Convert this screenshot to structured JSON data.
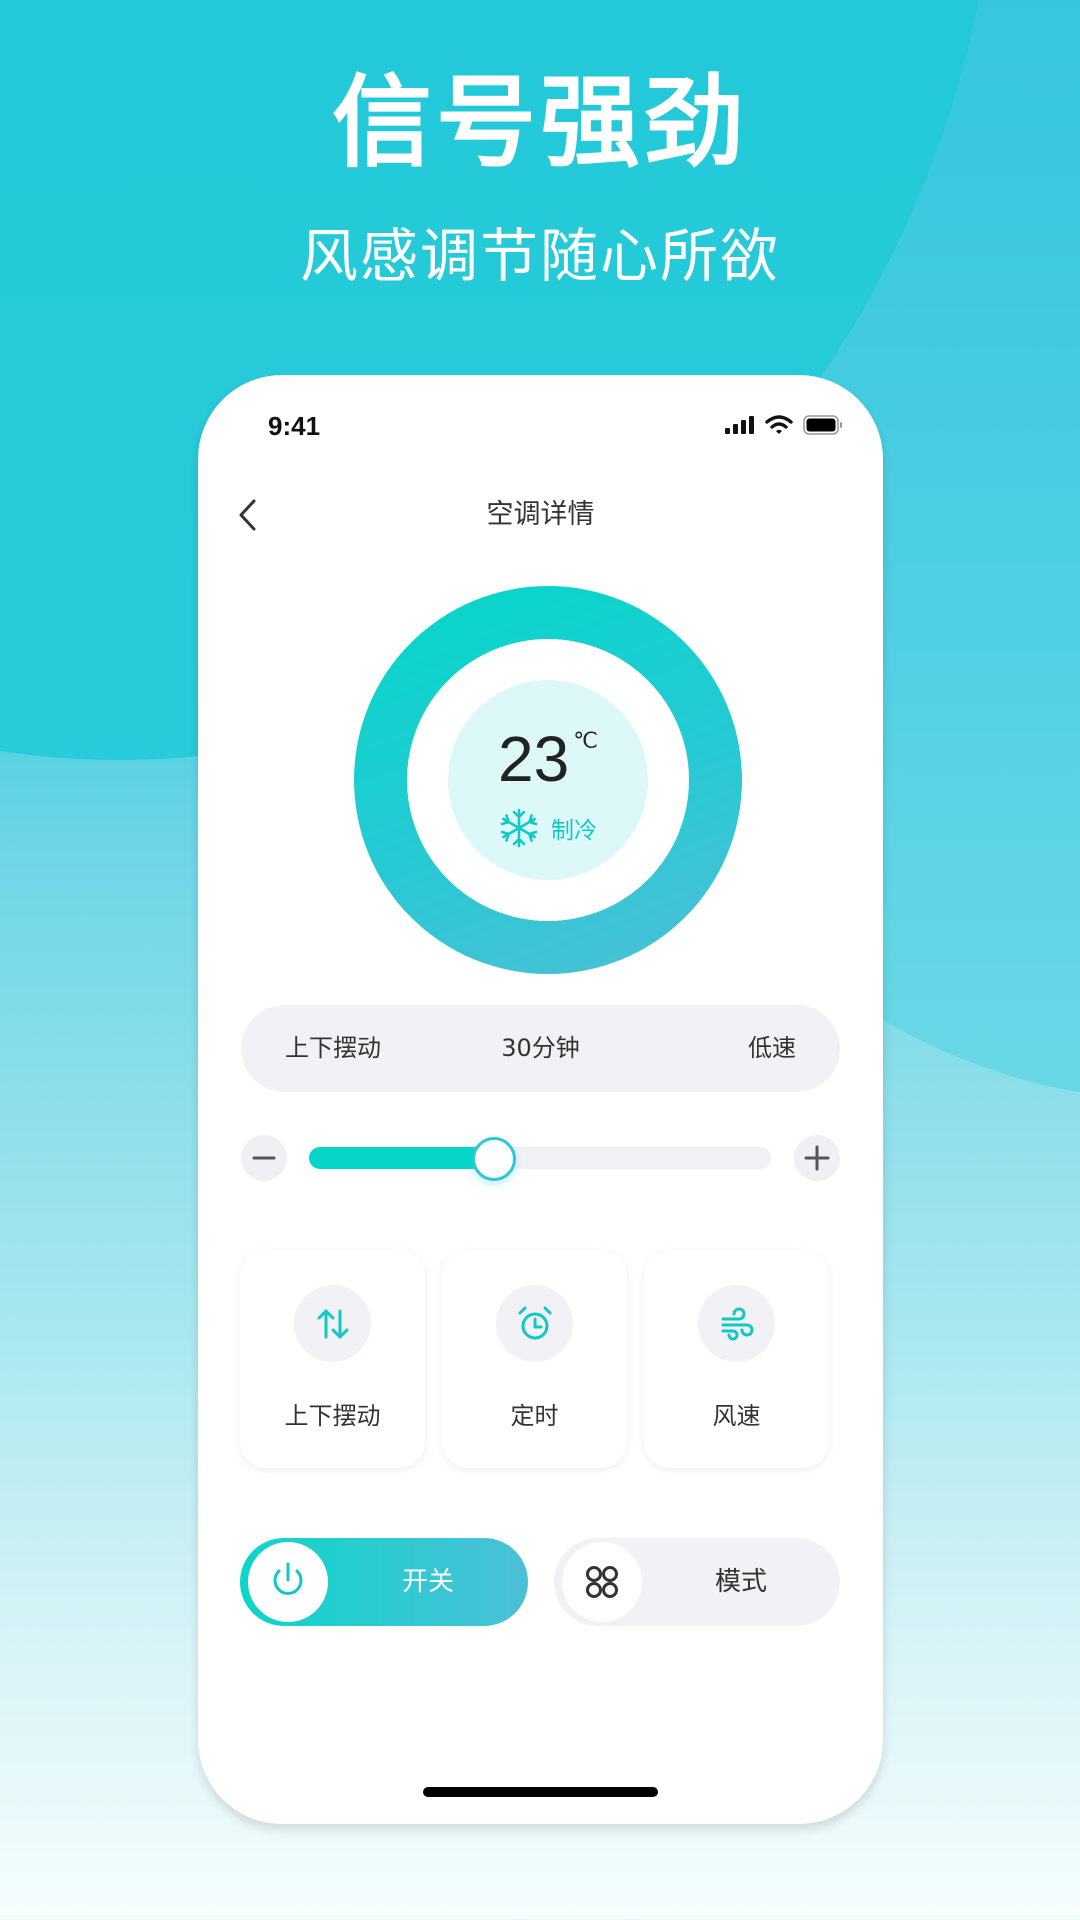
{
  "promo": {
    "headline": "信号强劲",
    "subheadline": "风感调节随心所欲"
  },
  "status_bar": {
    "time": "9:41",
    "icons": [
      "signal-icon",
      "wifi-icon",
      "battery-icon"
    ]
  },
  "nav": {
    "back_icon": "chevron-left-icon",
    "title": "空调详情"
  },
  "dial": {
    "temperature": "23",
    "unit": "℃",
    "mode_icon": "snowflake-icon",
    "mode_label": "制冷"
  },
  "info_bar": {
    "items": [
      {
        "label": "上下摆动"
      },
      {
        "label": "30分钟"
      },
      {
        "label": "低速"
      }
    ]
  },
  "slider": {
    "decrease_icon": "minus-icon",
    "increase_icon": "plus-icon",
    "value_fraction": 0.4
  },
  "function_cards": [
    {
      "icon": "swing-arrows-icon",
      "label": "上下摆动"
    },
    {
      "icon": "alarm-clock-icon",
      "label": "定时"
    },
    {
      "icon": "wind-icon",
      "label": "风速"
    }
  ],
  "controls": {
    "power": {
      "icon": "power-icon",
      "label": "开关"
    },
    "mode": {
      "icon": "grid-circles-icon",
      "label": "模式"
    }
  },
  "colors": {
    "accent": "#05D5C7",
    "accent_end": "#4BC0D8",
    "mode_text": "#11C9C4",
    "pill_bg": "#F2F2F6",
    "text": "#333333"
  }
}
